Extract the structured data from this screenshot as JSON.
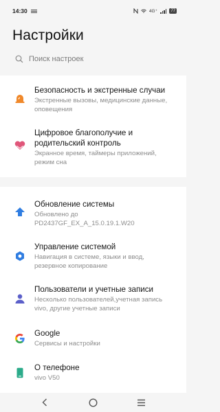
{
  "status": {
    "time": "14:30",
    "network": "4G⁺",
    "battery": "77"
  },
  "title": "Настройки",
  "search": {
    "placeholder": "Поиск настроек"
  },
  "groups": [
    {
      "items": [
        {
          "title": "Безопасность и экстренные случаи",
          "subtitle": "Экстренные вызовы, медицинские данные, оповещения",
          "icon": "alarm-light-icon",
          "color": "#f0882a"
        },
        {
          "title": "Цифровое благополучие и родительский контроль",
          "subtitle": "Экранное время, таймеры приложений, режим сна",
          "icon": "heart-hands-icon",
          "color": "#e0567a"
        }
      ]
    },
    {
      "items": [
        {
          "title": "Обновление системы",
          "subtitle": "Обновлено до PD2437GF_EX_A_15.0.19.1.W20",
          "icon": "upload-arrow-icon",
          "color": "#2f7de1"
        },
        {
          "title": "Управление системой",
          "subtitle": "Навигация в системе, языки и ввод, резервное копирование",
          "icon": "hexagon-gear-icon",
          "color": "#2f7de1"
        },
        {
          "title": "Пользователи и учетные записи",
          "subtitle": "Несколько пользователей,учетная запись vivo, другие учетные записи",
          "icon": "person-icon",
          "color": "#5b5fc9"
        },
        {
          "title": "Google",
          "subtitle": "Сервисы и настройки",
          "icon": "google-icon",
          "color": "#3c78d8"
        },
        {
          "title": "О телефоне",
          "subtitle": "vivo V50",
          "icon": "phone-icon",
          "color": "#2bab8a"
        }
      ]
    }
  ]
}
